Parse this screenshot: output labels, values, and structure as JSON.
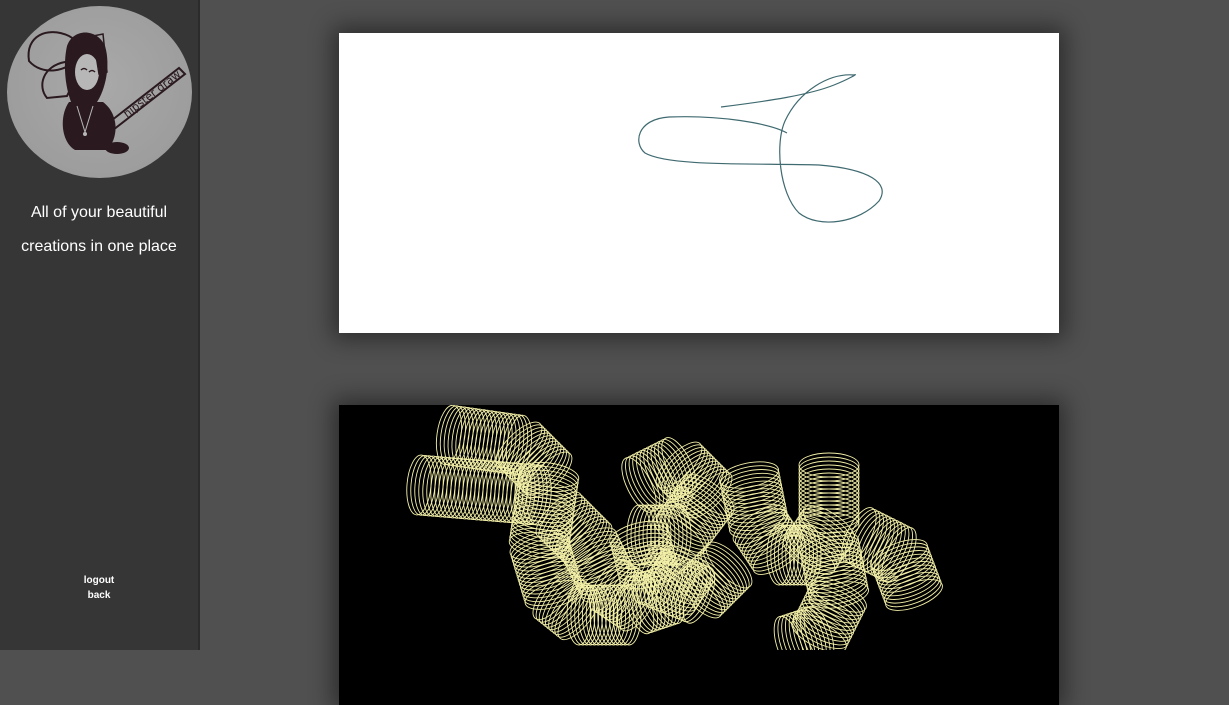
{
  "sidebar": {
    "logo": {
      "icon": "hipster-draw-logo",
      "text": "hipster draw"
    },
    "tagline": [
      "All of your beautiful",
      "creations in one place"
    ],
    "links": [
      {
        "label": "logout"
      },
      {
        "label": "back"
      }
    ]
  },
  "gallery": {
    "drawings": [
      {
        "background": "#ffffff",
        "stroke": "#3f6a70",
        "description": "scribble-drawing"
      },
      {
        "background": "#000000",
        "stroke": "#f3f0a8",
        "text": "hey"
      }
    ]
  }
}
